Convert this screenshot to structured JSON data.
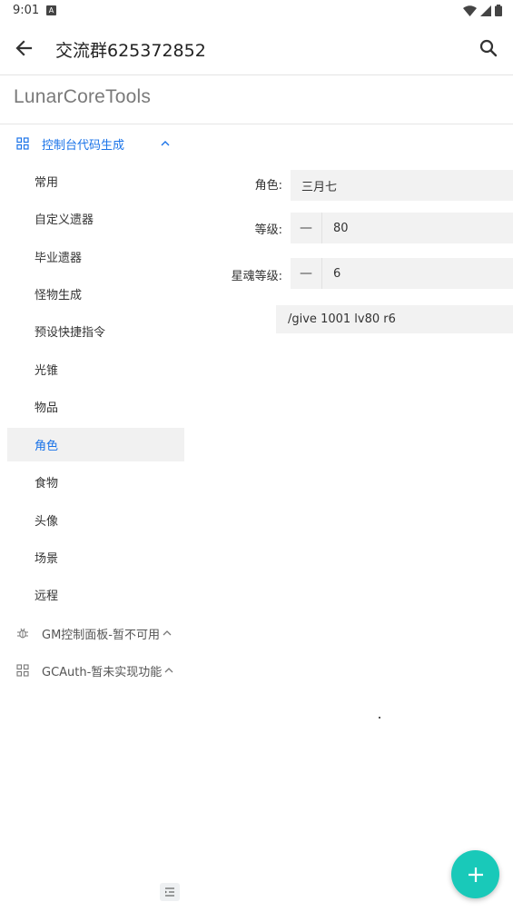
{
  "status": {
    "time": "9:01",
    "notif_letter": "A"
  },
  "appbar": {
    "title": "交流群625372852",
    "back_icon": "arrow-left-icon",
    "search_icon": "search-icon"
  },
  "brand": "LunarCoreTools",
  "sidebar": {
    "groups": [
      {
        "label": "控制台代码生成",
        "icon": "grid-icon",
        "expanded": true
      },
      {
        "label": "GM控制面板-暂不可用",
        "icon": "bug-icon",
        "expanded": false
      },
      {
        "label": "GCAuth-暂未实现功能",
        "icon": "grid-icon",
        "expanded": false
      }
    ],
    "items": [
      "常用",
      "自定义遗器",
      "毕业遗器",
      "怪物生成",
      "预设快捷指令",
      "光锥",
      "物品",
      "角色",
      "食物",
      "头像",
      "场景",
      "远程"
    ],
    "active": "角色"
  },
  "form": {
    "character": {
      "label": "角色:",
      "value": "三月七"
    },
    "level": {
      "label": "等级:",
      "minus": "—",
      "value": "80"
    },
    "eidolon": {
      "label": "星魂等级:",
      "minus": "—",
      "value": "6"
    },
    "command": "/give 1001 lv80 r6"
  },
  "colors": {
    "accent": "#1a73e8",
    "fab": "#19c9b9",
    "field_bg": "#f2f2f2",
    "active_bg": "#f1f1f1"
  }
}
